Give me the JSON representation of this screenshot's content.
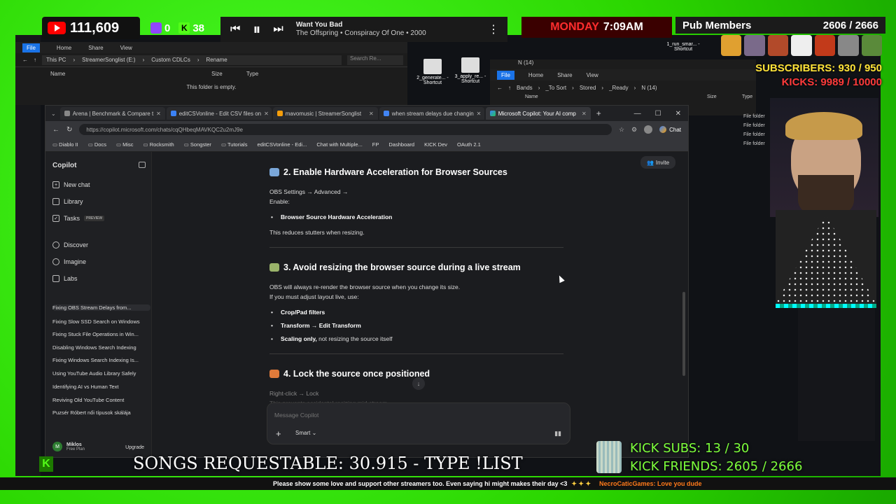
{
  "overlay": {
    "youtube_subs": "111,609",
    "twitch_count": "0",
    "kick_count": "38",
    "now_playing": {
      "title": "Want You Bad",
      "artist_album": "The Offspring • Conspiracy Of One • 2000"
    },
    "day": "MONDAY",
    "time": "7:09AM",
    "pub_members_label": "Pub Members",
    "pub_members_count": "2606 / 2666",
    "subscribers": "SUBSCRIBERS: 930 / 950",
    "kicks": "KICKS: 9989 / 10000",
    "songs_requestable": "SONGS REQUESTABLE: 30.915 - TYPE !LIST",
    "kick_subs": "KICK SUBS: 13 / 30",
    "kick_friends": "KICK FRIENDS: 2605 / 2666",
    "ticker_text": "Please show some love and support other streamers too. Even saying hi might makes their day <3",
    "ticker_user": "NecroCaticGames: Love you dude",
    "colors": {
      "green_screen": "#33e000",
      "subs_yellow": "#ffe338",
      "kick_green": "#53fc18"
    }
  },
  "explorer_left": {
    "title": "Rename",
    "menu": [
      "File",
      "Home",
      "Share",
      "View"
    ],
    "path": [
      "This PC",
      "StreamerSonglist (E:)",
      "Custom CDLCs",
      "Rename"
    ],
    "search_placeholder": "Search Re...",
    "columns": [
      "Name",
      "Size",
      "Type"
    ],
    "empty_message": "This folder is empty."
  },
  "shortcuts": [
    {
      "label": "2_generate... - Shortcut"
    },
    {
      "label": "3_apply_re... - Shortcut"
    },
    {
      "label": "1_run_smar... - Shortcut"
    }
  ],
  "explorer_right": {
    "title": "N (14)",
    "menu": [
      "File",
      "Home",
      "Share",
      "View"
    ],
    "path": [
      "Bands",
      "_To Sort",
      "Stored",
      "_Ready",
      "N (14)"
    ],
    "columns": [
      "Name",
      "Size",
      "Type"
    ],
    "types": [
      "File folder",
      "File folder",
      "File folder",
      "File folder"
    ]
  },
  "browser": {
    "tabs": [
      {
        "label": "Arena | Benchmark & Compare t"
      },
      {
        "label": "editCSVonline - Edit CSV files on"
      },
      {
        "label": "mavomusic | StreamerSonglist"
      },
      {
        "label": "when stream delays due changin"
      },
      {
        "label": "Microsoft Copilot: Your AI comp"
      }
    ],
    "url": "https://copilot.microsoft.com/chats/cqQHbeqMAVKQC2u2mJ9e",
    "chat_button": "Chat",
    "bookmarks": [
      "Diablo II",
      "Docs",
      "Misc",
      "Rocksmith",
      "Songster",
      "Tutorials",
      "editCSVonline - Edi...",
      "Chat with Multiple...",
      "FP",
      "Dashboard",
      "KICK Dev",
      "OAuth 2.1"
    ]
  },
  "copilot": {
    "brand": "Copilot",
    "nav": [
      {
        "label": "New chat"
      },
      {
        "label": "Library"
      },
      {
        "label": "Tasks",
        "badge": "PREVIEW"
      },
      {
        "label": "Discover"
      },
      {
        "label": "Imagine"
      },
      {
        "label": "Labs"
      }
    ],
    "history": [
      "Fixing OBS Stream Delays from...",
      "Fixing Slow SSD Search on Windows",
      "Fixing Stuck File Operations in Win...",
      "Disabling Windows Search Indexing",
      "Fixing Windows Search Indexing Is...",
      "Using YouTube Audio Library Safely",
      "Identifying AI vs Human Text",
      "Reviving Old YouTube Content",
      "Puzsér Róbert női típusok skálája"
    ],
    "user": {
      "name": "Miklos",
      "plan": "Free Plan",
      "initial": "M",
      "upgrade": "Upgrade"
    },
    "invite": "Invite",
    "content": {
      "h2": "2. Enable Hardware Acceleration for Browser Sources",
      "h2_p1": "OBS Settings → Advanced →",
      "h2_p2": "Enable:",
      "h2_li1": "Browser Source Hardware Acceleration",
      "h2_p3": "This reduces stutters when resizing.",
      "h3": "3. Avoid resizing the browser source during a live stream",
      "h3_p1": "OBS will always re-render the browser source when you change its size.",
      "h3_p2": "If you must adjust layout live, use:",
      "h3_li1": "Crop/Pad filters",
      "h3_li2": "Transform → Edit Transform",
      "h3_li3_bold": "Scaling only,",
      "h3_li3_rest": "not resizing the source itself",
      "h4": "4. Lock the source once positioned",
      "h4_p1": "Right-click → Lock",
      "h4_p2": "This prevents accidental resizing mid-stream."
    },
    "composer_placeholder": "Message Copilot",
    "mode": "Smart"
  }
}
